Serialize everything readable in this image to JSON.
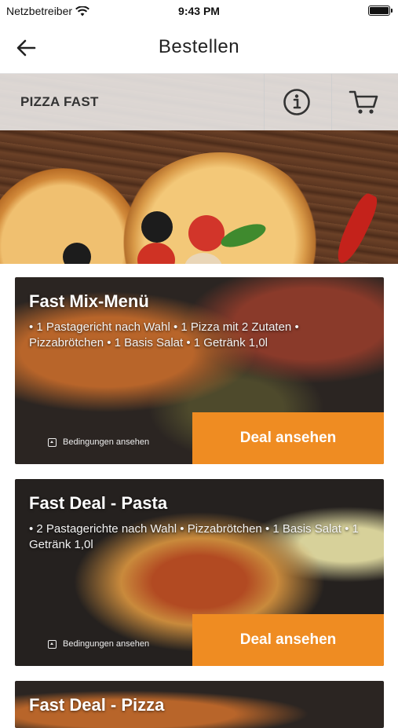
{
  "status_bar": {
    "carrier": "Netzbetreiber",
    "time": "9:43 PM",
    "icons": [
      "wifi-icon",
      "battery-icon"
    ]
  },
  "nav": {
    "title": "Bestellen",
    "back_icon": "arrow-left-icon"
  },
  "restaurant": {
    "name": "PIZZA FAST",
    "info_icon": "info-icon",
    "cart_icon": "cart-icon"
  },
  "colors": {
    "accent": "#ef8c22"
  },
  "deals": [
    {
      "title": "Fast Mix-Menü",
      "description": "• 1 Pastagericht nach Wahl • 1 Pizza mit 2 Zutaten • Pizzabrötchen • 1 Basis Salat • 1 Getränk 1,0l",
      "terms_label": "Bedingungen ansehen",
      "button_label": "Deal ansehen"
    },
    {
      "title": "Fast Deal - Pasta",
      "description": "• 2 Pastagerichte nach Wahl • Pizzabrötchen • 1 Basis Salat • 1 Getränk 1,0l",
      "terms_label": "Bedingungen ansehen",
      "button_label": "Deal ansehen"
    },
    {
      "title": "Fast Deal - Pizza"
    }
  ]
}
